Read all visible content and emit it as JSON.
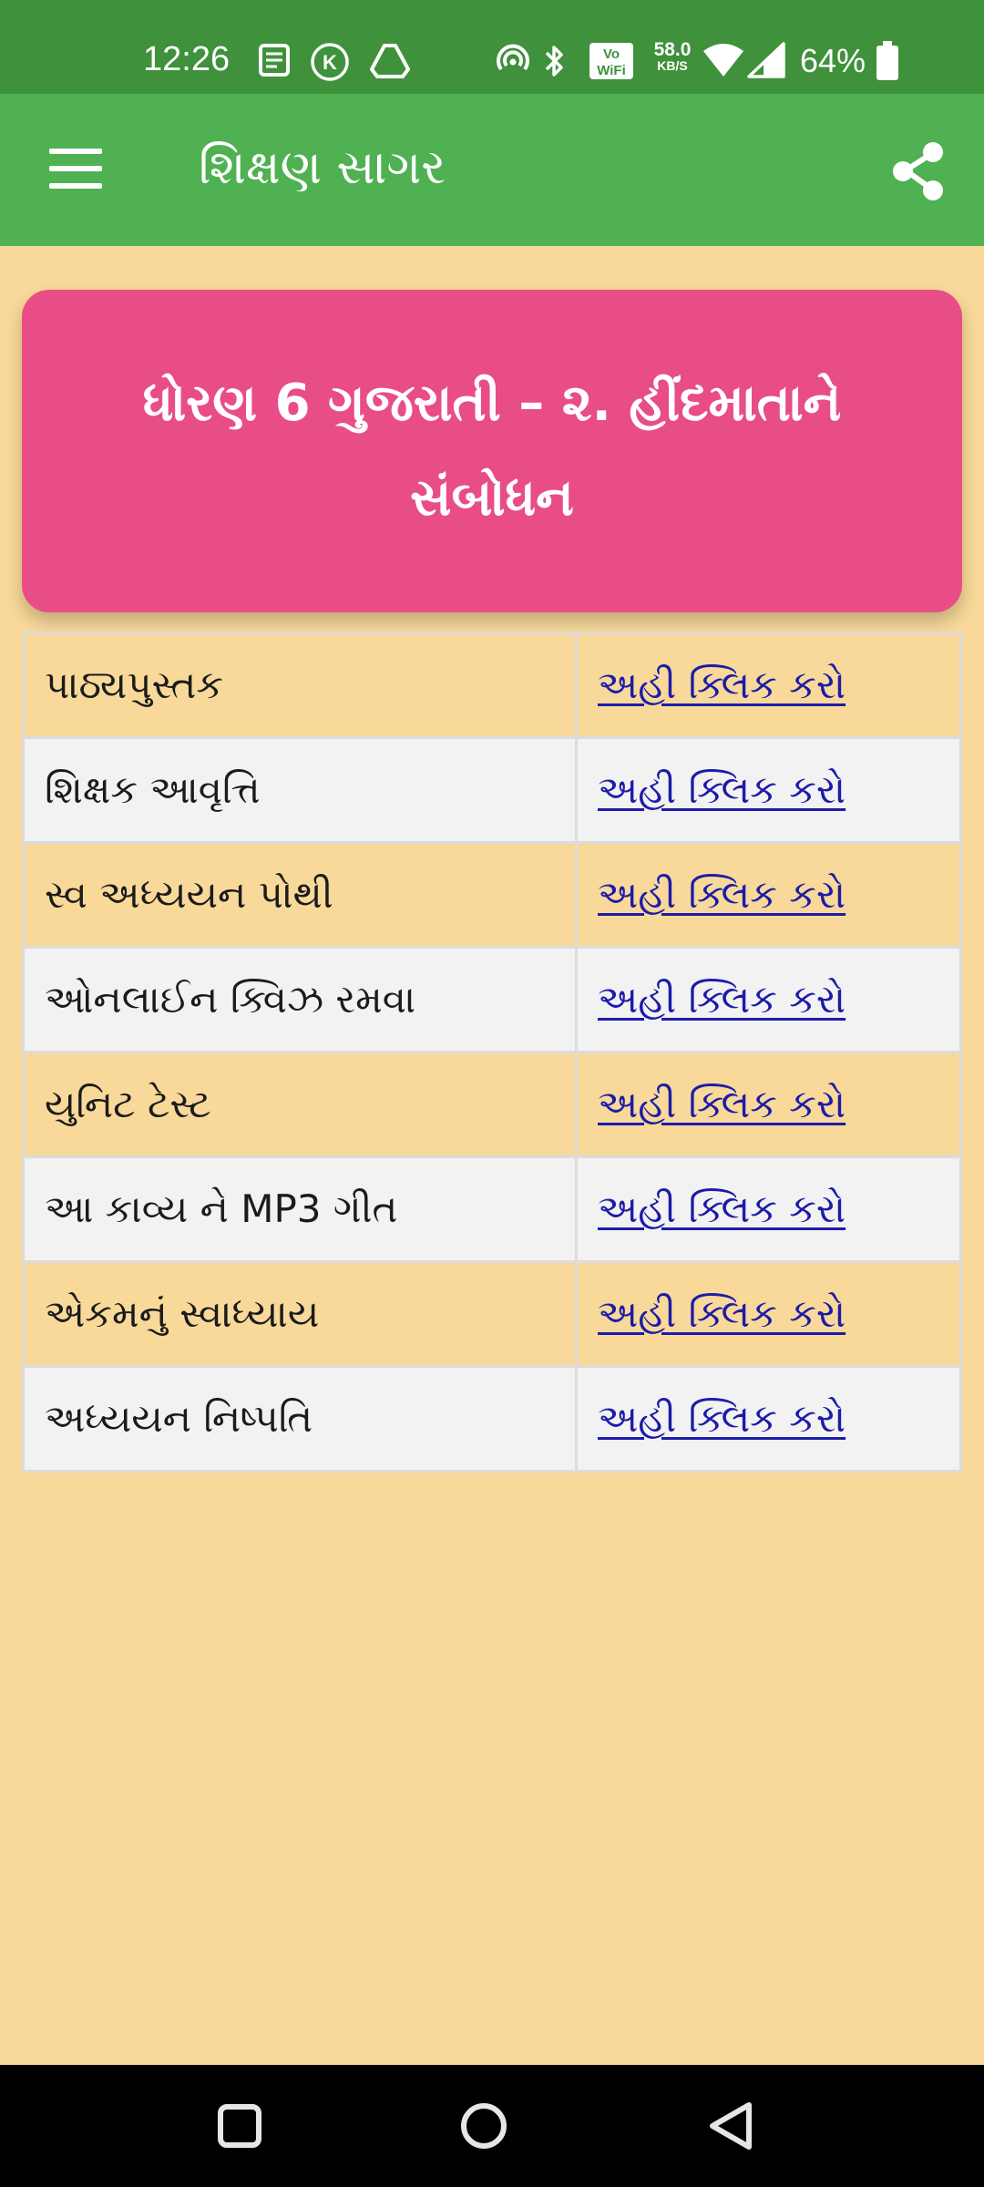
{
  "status_bar": {
    "time": "12:26",
    "net_speed_value": "58.0",
    "net_speed_unit": "KB/S",
    "battery_percent": "64%",
    "wifi_badge_top": "Vo",
    "wifi_badge_bottom": "WiFi",
    "notification_icons": [
      "news-icon",
      "k-circle-icon",
      "drive-icon"
    ],
    "system_icons": [
      "hotspot-icon",
      "bluetooth-icon",
      "vowifi-icon",
      "wifi-icon",
      "cellular-signal-icon",
      "battery-icon"
    ]
  },
  "app_bar": {
    "title": "શિક્ષણ સાગર",
    "menu_icon": "hamburger-menu-icon",
    "share_icon": "share-icon",
    "color": "#4fb152"
  },
  "header_card": {
    "title": "ધોરણ 6 ગુજરાતી – ૨. હીંદમાતાને સંબોધન",
    "color": "#e84d87"
  },
  "resources": [
    {
      "name": "પાઠ્યપુસ્તક",
      "link": "અહી ક્લિક કરો"
    },
    {
      "name": "શિક્ષક આવૃત્તિ",
      "link": "અહી ક્લિક કરો"
    },
    {
      "name": "સ્વ અધ્યયન પોથી",
      "link": "અહી ક્લિક કરો"
    },
    {
      "name": "ઓનલાઈન ક્વિઝ રમવા",
      "link": "અહી ક્લિક કરો"
    },
    {
      "name": "યુનિટ ટેસ્ટ",
      "link": "અહી ક્લિક કરો"
    },
    {
      "name": "આ કાવ્ય ને MP3 ગીત",
      "link": "અહી ક્લિક કરો"
    },
    {
      "name": "એકમનું સ્વાધ્યાય",
      "link": "અહી ક્લિક કરો"
    },
    {
      "name": "અધ્યયન નિષ્પતિ",
      "link": "અહી ક્લિક કરો"
    }
  ],
  "theme": {
    "page_background": "#f8d999",
    "status_bar": "#3f913b",
    "link_color": "#1c1ca8",
    "alt_row": "#f2f2f2"
  },
  "nav_bar": {
    "buttons": [
      "recents-square-icon",
      "home-circle-icon",
      "back-triangle-icon"
    ]
  }
}
